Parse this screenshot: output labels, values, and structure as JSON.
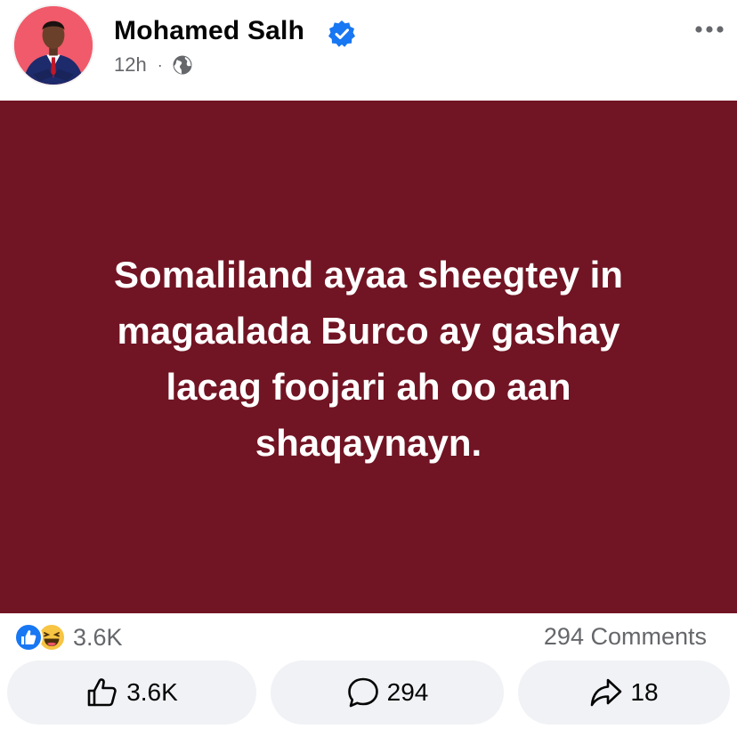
{
  "post": {
    "author_name": "Mohamed Salh",
    "time": "12h",
    "separator": "·",
    "text": "Somaliland ayaa sheegtey in magaalada Burco ay gashay lacag foojari ah oo aan shaqaynayn.",
    "background_color": "#711423"
  },
  "stats": {
    "reactions_count": "3.6K",
    "comments_label": "294 Comments"
  },
  "actions": {
    "like_label": "3.6K",
    "comment_label": "294",
    "share_label": "18"
  },
  "icons": [
    "avatar",
    "verified-badge-icon",
    "globe-icon",
    "more-options-icon",
    "like-reaction-icon",
    "haha-reaction-icon",
    "thumbs-up-icon",
    "comment-bubble-icon",
    "share-arrow-icon"
  ]
}
